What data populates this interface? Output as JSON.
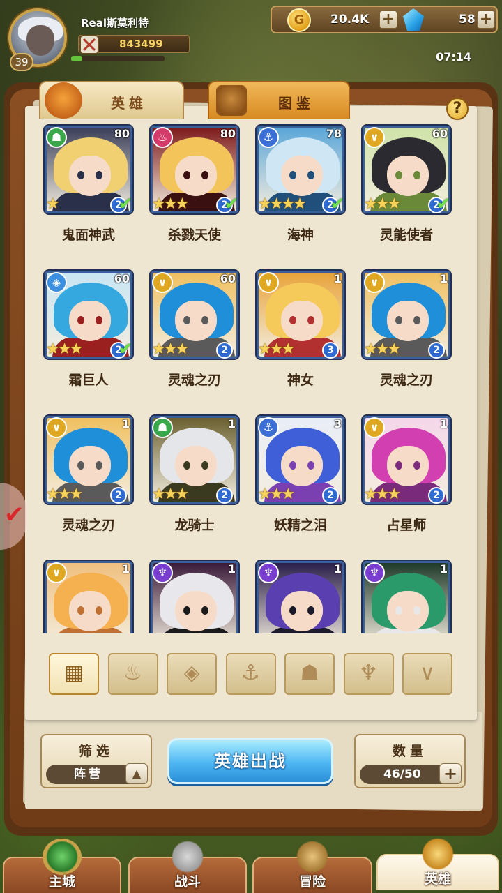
{
  "player": {
    "name": "Real斯莫利特",
    "level": "39",
    "power": "843499",
    "xp_fraction": 0.12
  },
  "resources": {
    "gold": "20.4K",
    "gems": "58",
    "coin_glyph": "G",
    "plus": "+"
  },
  "clock": "07:14",
  "tabs": {
    "heroes": "英雄",
    "atlas": "图鉴"
  },
  "help": "?",
  "heroes": [
    {
      "name": "鬼面神武",
      "level": "80",
      "faction_icon": "beast-icon",
      "faction_color": "#3aa84a",
      "stars": "★",
      "rank": "2",
      "checked": true,
      "colors": [
        "#3b3f5a",
        "#f0d070",
        "#2a2f4a"
      ]
    },
    {
      "name": "杀戮天使",
      "level": "80",
      "faction_icon": "flame-icon",
      "faction_color": "#d43a6a",
      "stars": "★★★",
      "rank": "2",
      "checked": true,
      "colors": [
        "#7d1a1a",
        "#f2c45a",
        "#3a1010"
      ]
    },
    {
      "name": "海神",
      "level": "78",
      "faction_icon": "anchor-icon",
      "faction_color": "#3b6fd6",
      "stars": "★★★★",
      "rank": "2",
      "checked": true,
      "colors": [
        "#5aa6d8",
        "#cfe6f4",
        "#1f4f7a"
      ]
    },
    {
      "name": "灵能使者",
      "level": "60",
      "faction_icon": "chevron-icon",
      "faction_color": "#e0a821",
      "stars": "★★★",
      "rank": "2",
      "checked": true,
      "colors": [
        "#cfe3a8",
        "#2a2a30",
        "#6a8a3a"
      ]
    },
    {
      "name": "霜巨人",
      "level": "60",
      "faction_icon": "diamond-icon",
      "faction_color": "#3b8fe0",
      "stars": "★★★",
      "rank": "2",
      "checked": true,
      "colors": [
        "#c8e6f4",
        "#35a8e0",
        "#9a2020"
      ]
    },
    {
      "name": "灵魂之刃",
      "level": "60",
      "faction_icon": "chevron-icon",
      "faction_color": "#e0a821",
      "stars": "★★★",
      "rank": "2",
      "checked": false,
      "colors": [
        "#f0c060",
        "#1e8fd8",
        "#5a5a5a"
      ]
    },
    {
      "name": "神女",
      "level": "1",
      "faction_icon": "chevron-icon",
      "faction_color": "#e0a821",
      "stars": "★★★",
      "rank": "3",
      "checked": false,
      "colors": [
        "#e8a33a",
        "#f5c95a",
        "#b23030"
      ]
    },
    {
      "name": "灵魂之刃",
      "level": "1",
      "faction_icon": "chevron-icon",
      "faction_color": "#e0a821",
      "stars": "★★★",
      "rank": "2",
      "checked": false,
      "colors": [
        "#f0c060",
        "#1e8fd8",
        "#5a5a5a"
      ]
    },
    {
      "name": "灵魂之刃",
      "level": "1",
      "faction_icon": "chevron-icon",
      "faction_color": "#e0a821",
      "stars": "★★★",
      "rank": "2",
      "checked": false,
      "colors": [
        "#f0c060",
        "#1e8fd8",
        "#5a5a5a"
      ]
    },
    {
      "name": "龙骑士",
      "level": "1",
      "faction_icon": "beast-icon",
      "faction_color": "#3aa84a",
      "stars": "★★★",
      "rank": "2",
      "checked": false,
      "colors": [
        "#6a6030",
        "#e4e6ea",
        "#3a3a20"
      ]
    },
    {
      "name": "妖精之泪",
      "level": "3",
      "faction_icon": "anchor-icon",
      "faction_color": "#3b6fd6",
      "stars": "★★★",
      "rank": "2",
      "checked": false,
      "colors": [
        "#e9eef7",
        "#3f5fd8",
        "#7a3fb0"
      ]
    },
    {
      "name": "占星师",
      "level": "1",
      "faction_icon": "chevron-icon",
      "faction_color": "#e0a821",
      "stars": "★★★",
      "rank": "2",
      "checked": false,
      "colors": [
        "#f4d7ea",
        "#d23fb0",
        "#7a2a7a"
      ]
    },
    {
      "name": "",
      "level": "1",
      "faction_icon": "chevron-icon",
      "faction_color": "#e0a821",
      "stars": "",
      "rank": "",
      "checked": false,
      "colors": [
        "#f0c080",
        "#f5b050",
        "#c07030"
      ]
    },
    {
      "name": "",
      "level": "1",
      "faction_icon": "demon-icon",
      "faction_color": "#7a3fd0",
      "stars": "",
      "rank": "",
      "checked": false,
      "colors": [
        "#3a1a3a",
        "#e8e8ec",
        "#1a1a1a"
      ]
    },
    {
      "name": "",
      "level": "1",
      "faction_icon": "demon-icon",
      "faction_color": "#7a3fd0",
      "stars": "",
      "rank": "",
      "checked": false,
      "colors": [
        "#2a1f4a",
        "#5a3fb0",
        "#1a1a2a"
      ]
    },
    {
      "name": "",
      "level": "1",
      "faction_icon": "demon-icon",
      "faction_color": "#7a3fd0",
      "stars": "",
      "rank": "",
      "checked": false,
      "colors": [
        "#1f3a2a",
        "#2a9a6a",
        "#e8e8e8"
      ]
    }
  ],
  "filters": [
    "grid-icon",
    "flame-icon",
    "diamond-icon",
    "anchor-icon",
    "beast-icon",
    "demon-icon",
    "chevron-icon"
  ],
  "filter_glyphs": [
    "▦",
    "♨",
    "◈",
    "⚓",
    "☗",
    "♆",
    "∨"
  ],
  "filter_box": {
    "label": "筛选",
    "value": "阵营",
    "arrow": "▲"
  },
  "deploy": "英雄出战",
  "count_box": {
    "label": "数量",
    "value": "46/50",
    "plus": "+"
  },
  "side_tab_glyph": "✔",
  "nav": [
    {
      "label": "主城",
      "icon": "castle-icon",
      "active": false
    },
    {
      "label": "战斗",
      "icon": "crossed-swords-icon",
      "active": false
    },
    {
      "label": "冒险",
      "icon": "map-icon",
      "active": false
    },
    {
      "label": "英雄",
      "icon": "crown-icon",
      "active": true
    }
  ]
}
